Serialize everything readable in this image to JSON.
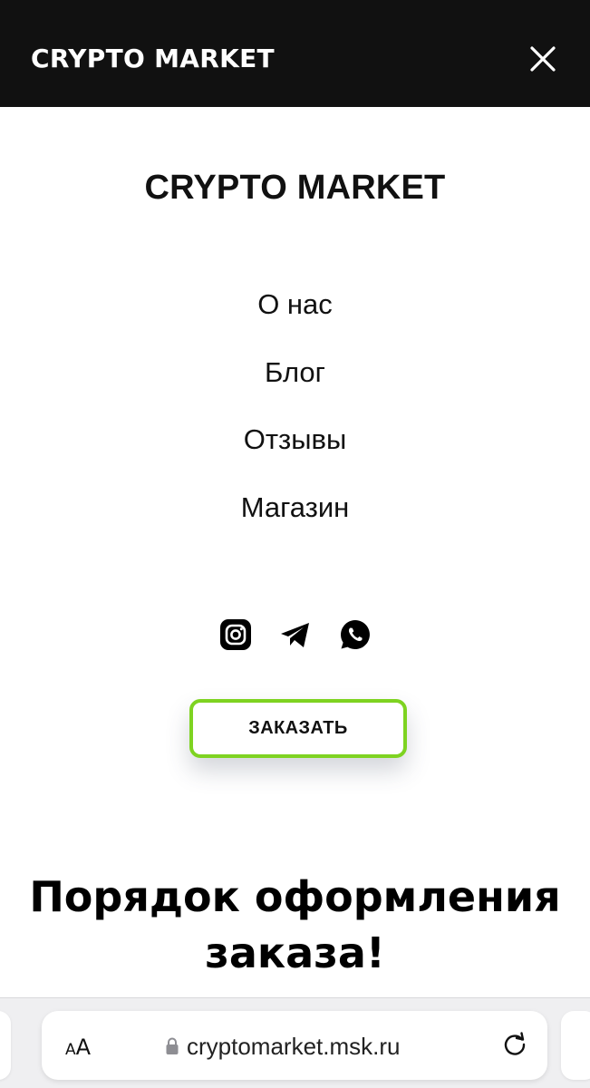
{
  "header": {
    "title": "CRYPTO MARKET",
    "close_icon": "close-icon"
  },
  "menu": {
    "brand": "CRYPTO MARKET",
    "items": [
      {
        "label": "О нас"
      },
      {
        "label": "Блог"
      },
      {
        "label": "Отзывы"
      },
      {
        "label": "Магазин"
      }
    ],
    "social_icons": [
      "instagram-icon",
      "telegram-icon",
      "whatsapp-icon"
    ],
    "order_button": "ЗАКАЗАТЬ"
  },
  "content": {
    "headline_line1": "Порядок оформления",
    "headline_line2": "заказа!"
  },
  "browser": {
    "text_size_small": "A",
    "text_size_large": "A",
    "url": "cryptomarket.msk.ru",
    "lock_icon": "lock-icon",
    "reload_icon": "reload-icon"
  },
  "colors": {
    "header_bg": "#111111",
    "accent_border": "#7ed321"
  }
}
